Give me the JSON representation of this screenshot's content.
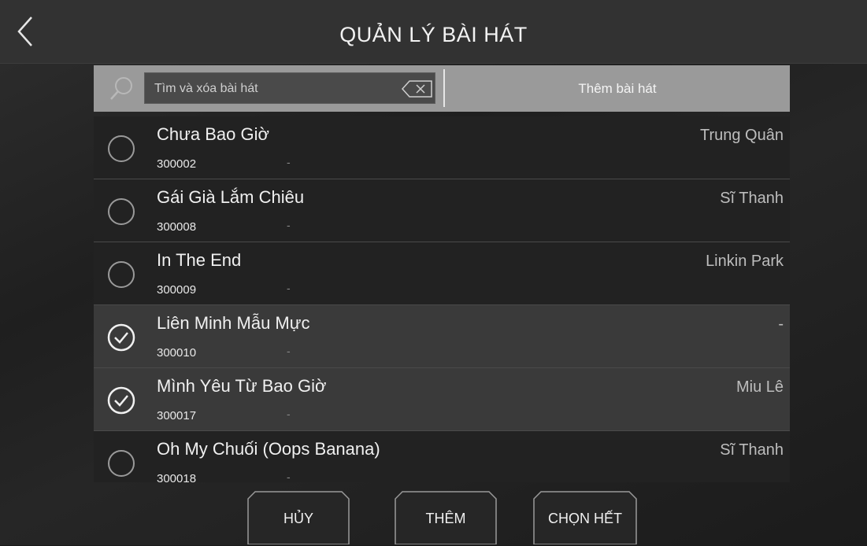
{
  "header": {
    "title": "QUẢN LÝ BÀI HÁT",
    "back_icon": "chevron-left-icon"
  },
  "toolbar": {
    "search_placeholder": "Tìm và xóa bài hát",
    "search_value": "",
    "search_icon": "search-icon",
    "clear_icon": "backspace-icon",
    "add_song_label": "Thêm bài hát"
  },
  "songs": [
    {
      "title": "Chưa Bao Giờ",
      "code": "300002",
      "sub": "-",
      "artist": "Trung Quân",
      "selected": false
    },
    {
      "title": "Gái Già Lắm Chiêu",
      "code": "300008",
      "sub": "-",
      "artist": "Sĩ Thanh",
      "selected": false
    },
    {
      "title": "In The End",
      "code": "300009",
      "sub": "-",
      "artist": "Linkin Park",
      "selected": false
    },
    {
      "title": "Liên Minh Mẫu Mực",
      "code": "300010",
      "sub": "-",
      "artist": "-",
      "selected": true
    },
    {
      "title": "Mình Yêu Từ Bao Giờ",
      "code": "300017",
      "sub": "-",
      "artist": "Miu Lê",
      "selected": true
    },
    {
      "title": "Oh My Chuối (Oops Banana)",
      "code": "300018",
      "sub": "-",
      "artist": "Sĩ Thanh",
      "selected": false
    }
  ],
  "footer": {
    "cancel_label": "HỦY",
    "add_label": "THÊM",
    "select_all_label": "CHỌN HẾT"
  },
  "colors": {
    "header_bg": "#323232",
    "toolbar_bg": "#9a9a9a",
    "row_bg": "#222222",
    "row_selected_bg": "#3a3a3a"
  }
}
